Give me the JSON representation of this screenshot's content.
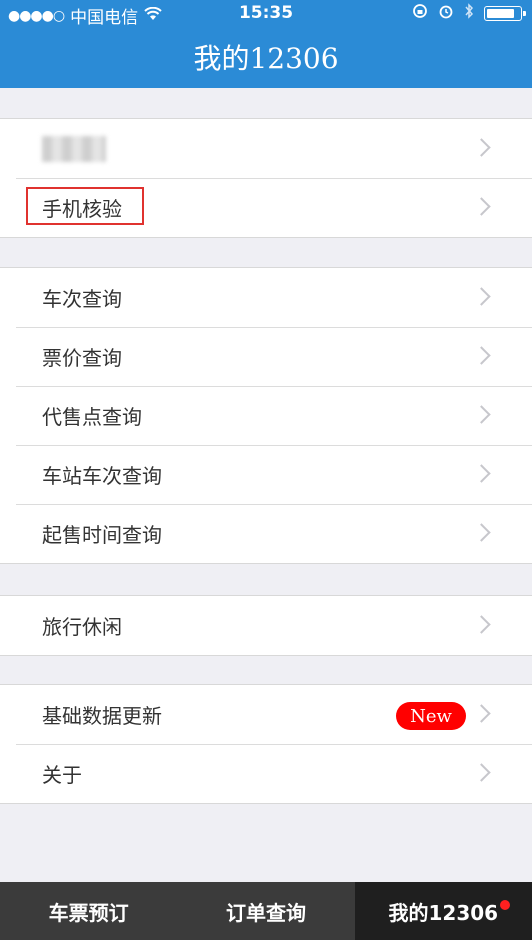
{
  "status_bar": {
    "signal": "●●●●○",
    "carrier": "中国电信",
    "wifi": "wifi-icon",
    "time": "15:35",
    "battery_level": 0.9
  },
  "nav": {
    "title": "我的12306"
  },
  "groups": {
    "account": {
      "phone_verify": "手机核验"
    },
    "queries": {
      "train_query": "车次查询",
      "fare_query": "票价查询",
      "agent_query": "代售点查询",
      "station_query": "车站车次查询",
      "sale_time_query": "起售时间查询"
    },
    "travel": {
      "leisure": "旅行休闲"
    },
    "other": {
      "data_update": "基础数据更新",
      "new_badge": "New",
      "about": "关于"
    }
  },
  "tabs": {
    "booking": "车票预订",
    "orders": "订单查询",
    "mine": "我的12306"
  },
  "colors": {
    "nav_blue": "#2b8bd6",
    "badge_red": "#ff0000",
    "highlight_red": "#e0322f",
    "tab_bar": "#3b3b3b"
  }
}
